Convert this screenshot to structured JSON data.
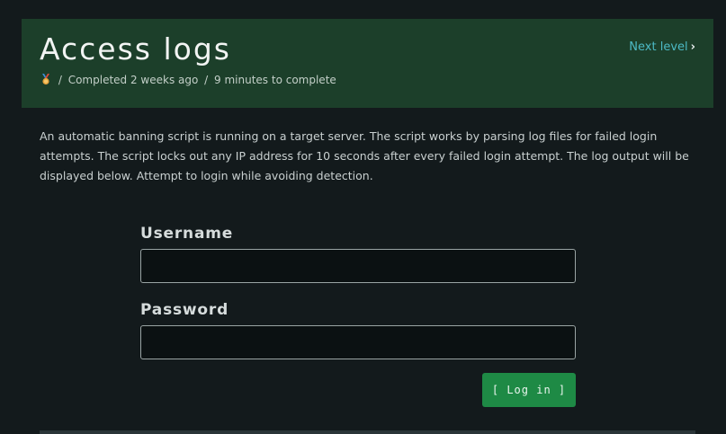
{
  "header": {
    "title": "Access logs",
    "next_label": "Next level",
    "next_chevron": "›",
    "meta": {
      "medal_icon": "medal-icon",
      "separator": "/",
      "completed": "Completed 2 weeks ago",
      "duration": "9 minutes to complete"
    }
  },
  "description": "An automatic banning script is running on a target server. The script works by parsing log files for failed login attempts. The script locks out any IP address for 10 seconds after every failed login attempt. The log output will be displayed below. Attempt to login while avoiding detection.",
  "form": {
    "username_label": "Username",
    "username_value": "",
    "password_label": "Password",
    "password_value": "",
    "login_label": "[ Log in ]"
  },
  "colors": {
    "background": "#131a1c",
    "header_bg": "#1c3f2a",
    "link": "#4cb9c4",
    "button": "#1e8a45"
  }
}
